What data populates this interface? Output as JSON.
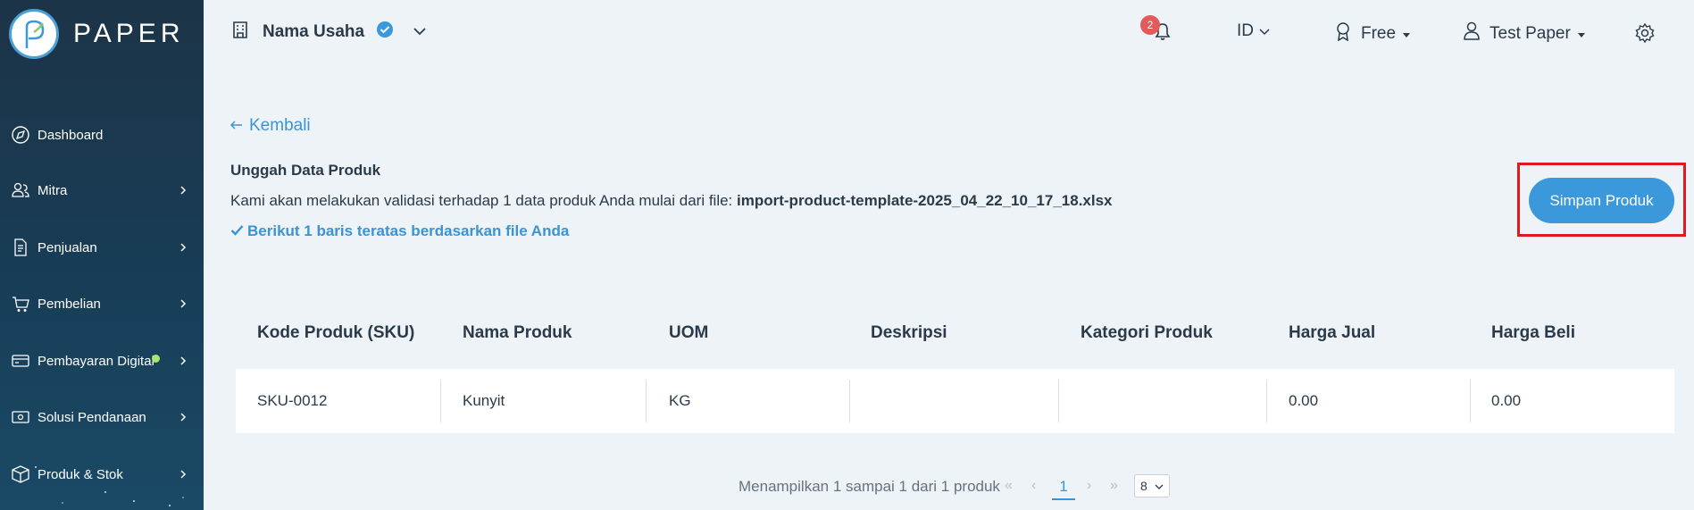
{
  "sidebar": {
    "logo_text": "PAPER",
    "items": [
      {
        "label": "Dashboard",
        "icon": "compass-icon",
        "has_chevron": false
      },
      {
        "label": "Mitra",
        "icon": "people-icon",
        "has_chevron": true
      },
      {
        "label": "Penjualan",
        "icon": "document-icon",
        "has_chevron": true
      },
      {
        "label": "Pembelian",
        "icon": "cart-icon",
        "has_chevron": true
      },
      {
        "label": "Pembayaran Digital",
        "icon": "card-icon",
        "has_chevron": true,
        "dot": true
      },
      {
        "label": "Solusi Pendanaan",
        "icon": "money-icon",
        "has_chevron": true
      },
      {
        "label": "Produk & Stok",
        "icon": "box-icon",
        "has_chevron": true
      }
    ]
  },
  "header": {
    "business_name": "Nama Usaha",
    "notification_count": "2",
    "language": "ID",
    "plan": "Free",
    "user": "Test Paper"
  },
  "content": {
    "back_label": "Kembali",
    "title": "Unggah Data Produk",
    "description_prefix": "Kami akan melakukan validasi terhadap 1 data produk Anda mulai dari file: ",
    "file_name": "import-product-template-2025_04_22_10_17_18.xlsx",
    "info_text": "Berikut 1 baris teratas berdasarkan file Anda",
    "save_button": "Simpan Produk"
  },
  "table": {
    "headers": [
      "Kode Produk (SKU)",
      "Nama Produk",
      "UOM",
      "Deskripsi",
      "Kategori Produk",
      "Harga Jual",
      "Harga Beli"
    ],
    "rows": [
      [
        "SKU-0012",
        "Kunyit",
        "KG",
        "",
        "",
        "0.00",
        "0.00"
      ]
    ]
  },
  "pagination": {
    "summary": "Menampilkan 1 sampai 1 dari 1 produk",
    "first": "«",
    "prev": "‹",
    "current_page": "1",
    "next": "›",
    "last": "»",
    "page_size": "8"
  },
  "colors": {
    "accent": "#3b98db",
    "sidebar_bg": "#1c3447",
    "highlight_box": "#e0191e",
    "badge": "#e45a5a"
  }
}
